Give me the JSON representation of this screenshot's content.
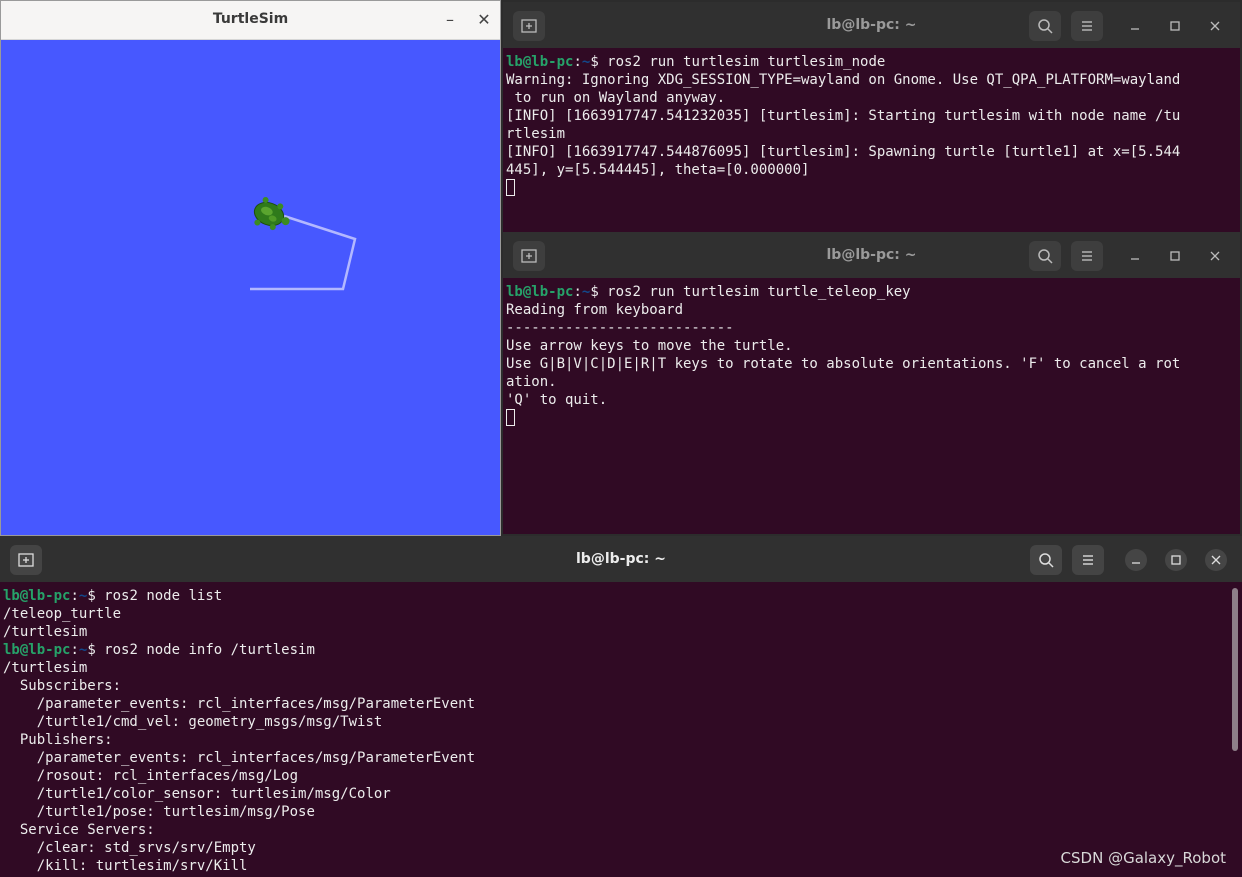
{
  "turtlesim": {
    "title": "TurtleSim",
    "minimize": "–",
    "close": "✕",
    "background_color": "#4758ff"
  },
  "term1": {
    "title": "lb@lb-pc: ~",
    "lines": [
      {
        "user": "lb@lb-pc",
        "path": "~",
        "cmd": " ros2 run turtlesim turtlesim_node"
      },
      {
        "text": "Warning: Ignoring XDG_SESSION_TYPE=wayland on Gnome. Use QT_QPA_PLATFORM=wayland"
      },
      {
        "text": " to run on Wayland anyway."
      },
      {
        "text": "[INFO] [1663917747.541232035] [turtlesim]: Starting turtlesim with node name /tu"
      },
      {
        "text": "rtlesim"
      },
      {
        "text": "[INFO] [1663917747.544876095] [turtlesim]: Spawning turtle [turtle1] at x=[5.544"
      },
      {
        "text": "445], y=[5.544445], theta=[0.000000]"
      },
      {
        "cursor": true
      }
    ]
  },
  "term2": {
    "title": "lb@lb-pc: ~",
    "lines": [
      {
        "user": "lb@lb-pc",
        "path": "~",
        "cmd": " ros2 run turtlesim turtle_teleop_key"
      },
      {
        "text": "Reading from keyboard"
      },
      {
        "text": "---------------------------"
      },
      {
        "text": "Use arrow keys to move the turtle."
      },
      {
        "text": "Use G|B|V|C|D|E|R|T keys to rotate to absolute orientations. 'F' to cancel a rot"
      },
      {
        "text": "ation."
      },
      {
        "text": "'Q' to quit."
      },
      {
        "cursor": true
      }
    ]
  },
  "term3": {
    "title": "lb@lb-pc: ~",
    "lines": [
      {
        "user": "lb@lb-pc",
        "path": "~",
        "cmd": " ros2 node list"
      },
      {
        "text": "/teleop_turtle"
      },
      {
        "text": "/turtlesim"
      },
      {
        "user": "lb@lb-pc",
        "path": "~",
        "cmd": " ros2 node info /turtlesim"
      },
      {
        "text": "/turtlesim"
      },
      {
        "text": "  Subscribers:"
      },
      {
        "text": "    /parameter_events: rcl_interfaces/msg/ParameterEvent"
      },
      {
        "text": "    /turtle1/cmd_vel: geometry_msgs/msg/Twist"
      },
      {
        "text": "  Publishers:"
      },
      {
        "text": "    /parameter_events: rcl_interfaces/msg/ParameterEvent"
      },
      {
        "text": "    /rosout: rcl_interfaces/msg/Log"
      },
      {
        "text": "    /turtle1/color_sensor: turtlesim/msg/Color"
      },
      {
        "text": "    /turtle1/pose: turtlesim/msg/Pose"
      },
      {
        "text": "  Service Servers:"
      },
      {
        "text": "    /clear: std_srvs/srv/Empty"
      },
      {
        "text": "    /kill: turtlesim/srv/Kill"
      }
    ]
  },
  "watermark": "CSDN @Galaxy_Robot",
  "colors": {
    "terminal_bg": "#300a24",
    "prompt_user": "#26a269",
    "prompt_path": "#12488b",
    "headerbar": "#303030"
  }
}
